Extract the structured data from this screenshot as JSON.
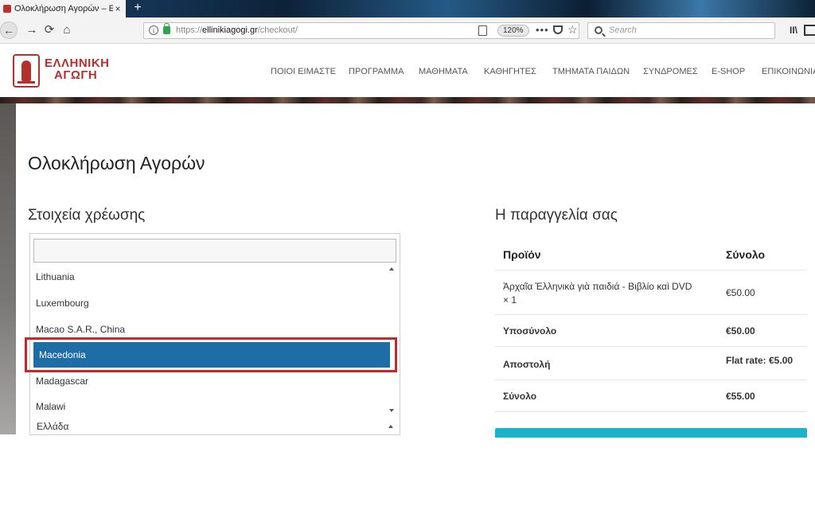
{
  "browser": {
    "tab_title": "Ολοκλήρωση Αγορών – Ελλη",
    "tab_close": "×",
    "new_tab": "+",
    "back": "←",
    "forward": "→",
    "reload": "⟳",
    "home": "⌂",
    "url_scheme": "https://",
    "url_host": "ellinikiagogi.gr",
    "url_path": "/checkout/",
    "zoom": "120%",
    "page_actions": "•••",
    "bookmark_star": "☆",
    "search_placeholder": "Search",
    "library": "II\\"
  },
  "site": {
    "logo_line1": "ΕΛΛΗΝΙΚΗ",
    "logo_line2": "ΑΓΩΓΗ",
    "nav": [
      "ΠΟΙΟΙ ΕΙΜΑΣΤΕ",
      "ΠΡΟΓΡΑΜΜΑ",
      "ΜΑΘΗΜΑΤΑ",
      "ΚΑΘΗΓΗΤΕΣ",
      "ΤΜΗΜΑΤΑ ΠΑΙΔΩΝ",
      "ΣΥΝΔΡΟΜΕΣ",
      "E-SHOP",
      "ΕΠΙΚΟΙΝΩΝΙΑ"
    ]
  },
  "page": {
    "title": "Ολοκλήρωση Αγορών",
    "billing_heading": "Στοιχεία χρέωσης",
    "order_heading": "Η παραγγελία σας"
  },
  "country_dropdown": {
    "search_value": "",
    "options": [
      "Lithuania",
      "Luxembourg",
      "Macao S.A.R., China",
      "Macedonia",
      "Madagascar",
      "Malawi"
    ],
    "selected": "Macedonia",
    "current_value": "Ελλάδα"
  },
  "order": {
    "header": {
      "product": "Προϊόν",
      "total": "Σύνολο"
    },
    "item_name_line1": "Ἀρχαῖα Ἑλληνικὰ γιὰ παιδιά - Βιβλίο καὶ DVD",
    "item_name_line2": "× 1",
    "item_total": "€50.00",
    "subtotal_label": "Υποσύνολο",
    "subtotal_value": "€50.00",
    "shipping_label": "Αποστολή",
    "shipping_value": "Flat rate: €5.00",
    "total_label": "Σύνολο",
    "total_value": "€55.00"
  },
  "colors": {
    "brand": "#b5302c",
    "selected_option": "#1f6da6",
    "highlight_box": "#c8262c",
    "checkout_button": "#1bb3c9"
  }
}
